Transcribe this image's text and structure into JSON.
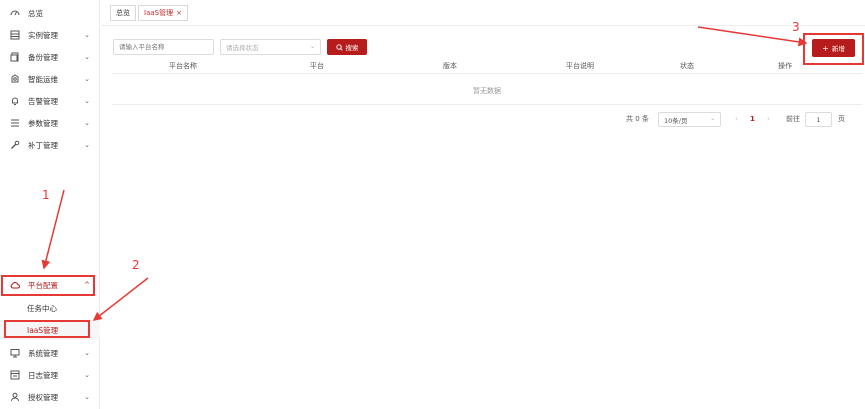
{
  "sidebar": {
    "items": [
      {
        "label": "总览",
        "icon": "dashboard-icon",
        "chevron": ""
      },
      {
        "label": "实例管理",
        "icon": "instance-icon",
        "chevron": "⌄"
      },
      {
        "label": "备份管理",
        "icon": "backup-icon",
        "chevron": "⌄"
      },
      {
        "label": "智能运维",
        "icon": "ops-icon",
        "chevron": "⌄"
      },
      {
        "label": "告警管理",
        "icon": "bell-icon",
        "chevron": "⌄"
      },
      {
        "label": "参数管理",
        "icon": "list-icon",
        "chevron": "⌄"
      },
      {
        "label": "补丁管理",
        "icon": "wrench-icon",
        "chevron": "⌄"
      },
      {
        "label": "平台配置",
        "icon": "cloud-icon",
        "chevron": "^"
      },
      {
        "label": "系统管理",
        "icon": "monitor-icon",
        "chevron": "⌄"
      },
      {
        "label": "日志管理",
        "icon": "log-icon",
        "chevron": "⌄"
      },
      {
        "label": "授权管理",
        "icon": "user-icon",
        "chevron": "⌄"
      }
    ],
    "sub_items": [
      {
        "label": "任务中心"
      },
      {
        "label": "IaaS管理"
      }
    ]
  },
  "tabs": [
    {
      "label": "总览"
    },
    {
      "label": "IaaS管理",
      "close": "×"
    }
  ],
  "toolbar": {
    "search_placeholder": "请输入平台名称",
    "status_placeholder": "请选择状态",
    "search_label": "搜索",
    "add_label": "新增"
  },
  "table": {
    "columns": [
      "平台名称",
      "平台",
      "版本",
      "平台说明",
      "状态",
      "操作"
    ],
    "empty_text": "暂无数据"
  },
  "pagination": {
    "total": "共 0 条",
    "page_size": "10条/页",
    "prev": "‹",
    "current_page": "1",
    "next": "›",
    "goto_label": "前往",
    "goto_value": "1",
    "page_suffix": "页"
  },
  "annotations": [
    "1",
    "2",
    "3"
  ],
  "colors": {
    "accent": "#b71c1c",
    "annotation": "#e53935"
  }
}
